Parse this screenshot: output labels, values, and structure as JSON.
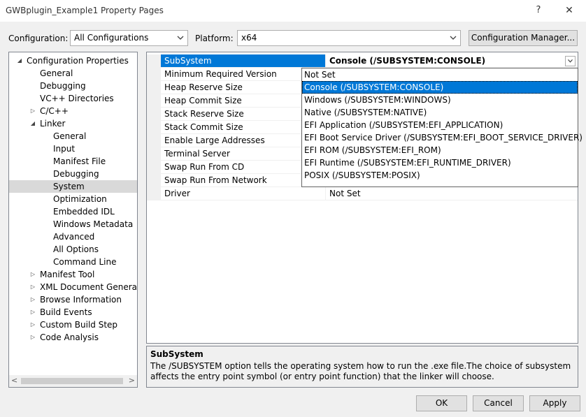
{
  "window": {
    "title": "GWBplugin_Example1 Property Pages",
    "help_glyph": "?",
    "close_glyph": "✕"
  },
  "config": {
    "configuration_label": "Configuration:",
    "configuration_value": "All Configurations",
    "platform_label": "Platform:",
    "platform_value": "x64",
    "manager_button": "Configuration Manager..."
  },
  "tree": {
    "nodes": [
      {
        "label": "Configuration Properties",
        "level": 0,
        "toggle": "◢"
      },
      {
        "label": "General",
        "level": 1,
        "toggle": ""
      },
      {
        "label": "Debugging",
        "level": 1,
        "toggle": ""
      },
      {
        "label": "VC++ Directories",
        "level": 1,
        "toggle": ""
      },
      {
        "label": "C/C++",
        "level": 1,
        "toggle": "▷"
      },
      {
        "label": "Linker",
        "level": 1,
        "toggle": "◢"
      },
      {
        "label": "General",
        "level": 2,
        "toggle": ""
      },
      {
        "label": "Input",
        "level": 2,
        "toggle": ""
      },
      {
        "label": "Manifest File",
        "level": 2,
        "toggle": ""
      },
      {
        "label": "Debugging",
        "level": 2,
        "toggle": ""
      },
      {
        "label": "System",
        "level": 2,
        "toggle": "",
        "selected": true
      },
      {
        "label": "Optimization",
        "level": 2,
        "toggle": ""
      },
      {
        "label": "Embedded IDL",
        "level": 2,
        "toggle": ""
      },
      {
        "label": "Windows Metadata",
        "level": 2,
        "toggle": ""
      },
      {
        "label": "Advanced",
        "level": 2,
        "toggle": ""
      },
      {
        "label": "All Options",
        "level": 2,
        "toggle": ""
      },
      {
        "label": "Command Line",
        "level": 2,
        "toggle": ""
      },
      {
        "label": "Manifest Tool",
        "level": 1,
        "toggle": "▷"
      },
      {
        "label": "XML Document Generator",
        "level": 1,
        "toggle": "▷"
      },
      {
        "label": "Browse Information",
        "level": 1,
        "toggle": "▷"
      },
      {
        "label": "Build Events",
        "level": 1,
        "toggle": "▷"
      },
      {
        "label": "Custom Build Step",
        "level": 1,
        "toggle": "▷"
      },
      {
        "label": "Code Analysis",
        "level": 1,
        "toggle": "▷"
      }
    ],
    "scroll_left_glyph": "<",
    "scroll_right_glyph": ">"
  },
  "grid": {
    "rows": [
      {
        "name": "SubSystem",
        "value": "Console (/SUBSYSTEM:CONSOLE)",
        "selected": true
      },
      {
        "name": "Minimum Required Version",
        "value": ""
      },
      {
        "name": "Heap Reserve Size",
        "value": ""
      },
      {
        "name": "Heap Commit Size",
        "value": ""
      },
      {
        "name": "Stack Reserve Size",
        "value": ""
      },
      {
        "name": "Stack Commit Size",
        "value": ""
      },
      {
        "name": "Enable Large Addresses",
        "value": ""
      },
      {
        "name": "Terminal Server",
        "value": ""
      },
      {
        "name": "Swap Run From CD",
        "value": ""
      },
      {
        "name": "Swap Run From Network",
        "value": ""
      },
      {
        "name": "Driver",
        "value": "Not Set"
      }
    ]
  },
  "dropdown": {
    "options": [
      {
        "label": "Not Set"
      },
      {
        "label": "Console (/SUBSYSTEM:CONSOLE)",
        "selected": true
      },
      {
        "label": "Windows (/SUBSYSTEM:WINDOWS)"
      },
      {
        "label": "Native (/SUBSYSTEM:NATIVE)"
      },
      {
        "label": "EFI Application (/SUBSYSTEM:EFI_APPLICATION)"
      },
      {
        "label": "EFI Boot Service Driver (/SUBSYSTEM:EFI_BOOT_SERVICE_DRIVER)"
      },
      {
        "label": "EFI ROM (/SUBSYSTEM:EFI_ROM)"
      },
      {
        "label": "EFI Runtime (/SUBSYSTEM:EFI_RUNTIME_DRIVER)"
      },
      {
        "label": "POSIX (/SUBSYSTEM:POSIX)"
      }
    ]
  },
  "description": {
    "title": "SubSystem",
    "text": "The /SUBSYSTEM option tells the operating system how to run the .exe file.The choice of subsystem affects the entry point symbol (or entry point function) that the linker will choose."
  },
  "buttons": {
    "ok": "OK",
    "cancel": "Cancel",
    "apply": "Apply"
  }
}
